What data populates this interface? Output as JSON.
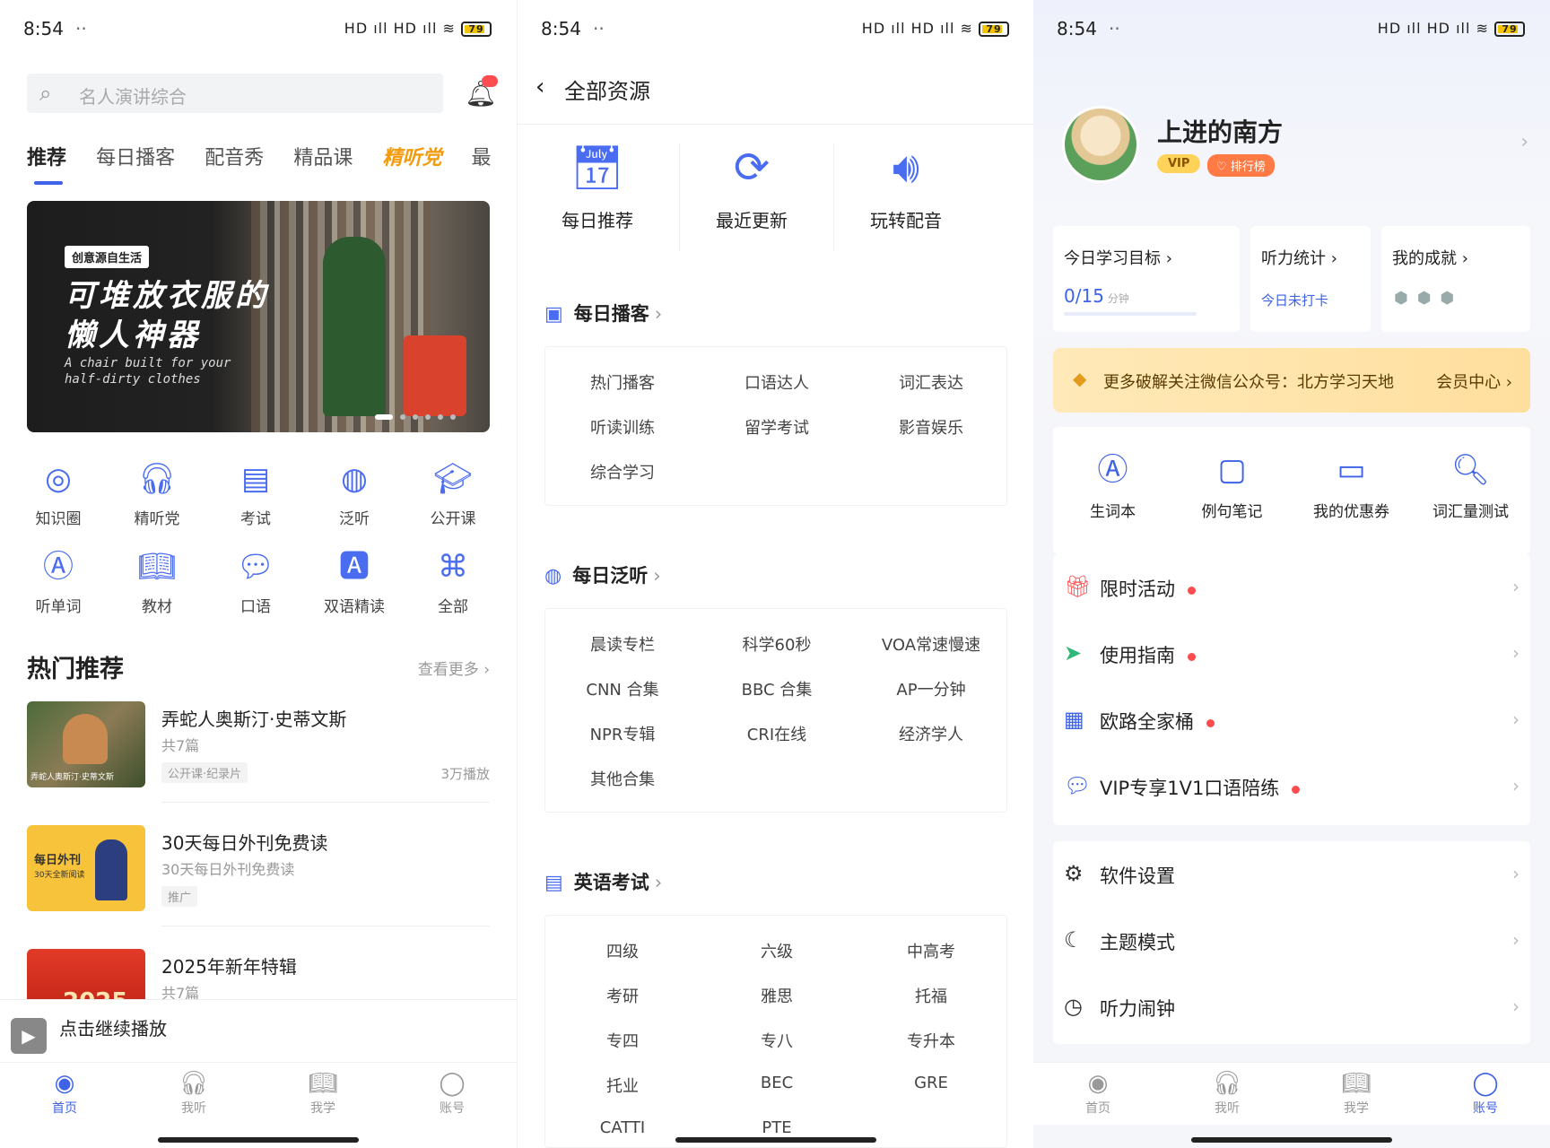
{
  "status": {
    "time": "8:54",
    "dots": "··",
    "signal": "HD ıll HD ıll ≋",
    "battery": "79"
  },
  "home": {
    "search_placeholder": "名人演讲综合",
    "tabs": [
      "推荐",
      "每日播客",
      "配音秀",
      "精品课",
      "精听党",
      "最"
    ],
    "banner": {
      "chip": "创意源自生活",
      "headline_1": "可堆放衣服的",
      "headline_2": "懒人神器",
      "en_1": "A chair built for your",
      "en_2": "half-dirty clothes",
      "slide_index": 1,
      "slide_count": 6
    },
    "grid": [
      {
        "label": "知识圈",
        "icon": "circle-icon"
      },
      {
        "label": "精听党",
        "icon": "headphones-icon"
      },
      {
        "label": "考试",
        "icon": "exam-icon"
      },
      {
        "label": "泛听",
        "icon": "globe-icon"
      },
      {
        "label": "公开课",
        "icon": "graduation-cap-icon"
      },
      {
        "label": "听单词",
        "icon": "word-icon"
      },
      {
        "label": "教材",
        "icon": "book-icon"
      },
      {
        "label": "口语",
        "icon": "chat-icon"
      },
      {
        "label": "双语精读",
        "icon": "bilingual-icon"
      },
      {
        "label": "全部",
        "icon": "all-icon"
      }
    ],
    "section_title": "热门推荐",
    "section_more": "查看更多",
    "recs": [
      {
        "title": "弄蛇人奥斯汀·史蒂文斯",
        "sub": "共7篇",
        "tag": "公开课·纪录片",
        "plays": "3万播放"
      },
      {
        "title": "30天每日外刊免费读",
        "sub": "30天每日外刊免费读",
        "tag": "推广",
        "plays": ""
      },
      {
        "title": "2025年新年特辑",
        "sub": "共7篇",
        "tag": "",
        "plays": ""
      }
    ],
    "thumb_texts": {
      "t1": "弄蛇人奥斯汀·史蒂文斯",
      "t2a": "每日外刊",
      "t2b": "30天全新阅读",
      "t3": "2025"
    },
    "mini_player": "点击继续播放",
    "nav": [
      "首页",
      "我听",
      "我学",
      "账号"
    ]
  },
  "resources": {
    "title": "全部资源",
    "top": [
      {
        "label": "每日推荐",
        "icon": "calendar-icon"
      },
      {
        "label": "最近更新",
        "icon": "refresh-icon"
      },
      {
        "label": "玩转配音",
        "icon": "voice-icon"
      }
    ],
    "categories": [
      {
        "title": "每日播客",
        "items": [
          "热门播客",
          "口语达人",
          "词汇表达",
          "听读训练",
          "留学考试",
          "影音娱乐",
          "综合学习"
        ]
      },
      {
        "title": "每日泛听",
        "items": [
          "晨读专栏",
          "科学60秒",
          "VOA常速慢速",
          "CNN 合集",
          "BBC 合集",
          "AP一分钟",
          "NPR专辑",
          "CRI在线",
          "经济学人",
          "其他合集"
        ]
      },
      {
        "title": "英语考试",
        "items": [
          "四级",
          "六级",
          "中高考",
          "考研",
          "雅思",
          "托福",
          "专四",
          "专八",
          "专升本",
          "托业",
          "BEC",
          "GRE",
          "CATTI",
          "PTE"
        ]
      }
    ]
  },
  "account": {
    "username": "上进的南方",
    "vip": "VIP",
    "rank": "♡ 排行榜",
    "stats": [
      {
        "title": "今日学习目标 ›",
        "value": "0/15",
        "unit": "分钟",
        "progress": 0
      },
      {
        "title": "听力统计 ›",
        "value": "今日未打卡"
      },
      {
        "title": "我的成就 ›",
        "value": ""
      }
    ],
    "promo_text": "更多破解关注微信公众号：北方学习天地",
    "promo_right": "会员中心 ›",
    "tools": [
      {
        "label": "生词本",
        "icon": "vocab-icon"
      },
      {
        "label": "例句笔记",
        "icon": "note-icon"
      },
      {
        "label": "我的优惠券",
        "icon": "coupon-icon"
      },
      {
        "label": "词汇量测试",
        "icon": "vocab-test-icon"
      }
    ],
    "menu1": [
      {
        "label": "限时活动",
        "icon": "gift-icon",
        "color": "#ff5a5a",
        "dot": true
      },
      {
        "label": "使用指南",
        "icon": "send-icon",
        "color": "#2fb877",
        "dot": true
      },
      {
        "label": "欧路全家桶",
        "icon": "apps-icon",
        "color": "#3e62e8",
        "dot": true
      },
      {
        "label": "VIP专享1V1口语陪练",
        "icon": "chat-icon",
        "color": "#3e62e8",
        "dot": true
      }
    ],
    "menu2": [
      {
        "label": "软件设置",
        "icon": "settings-icon"
      },
      {
        "label": "主题模式",
        "icon": "moon-icon"
      },
      {
        "label": "听力闹钟",
        "icon": "clock-icon"
      }
    ]
  },
  "colors": {
    "accent": "#3e62e8",
    "promo_bg": "#ffe3a6",
    "badge_red": "#ff4d4f"
  }
}
